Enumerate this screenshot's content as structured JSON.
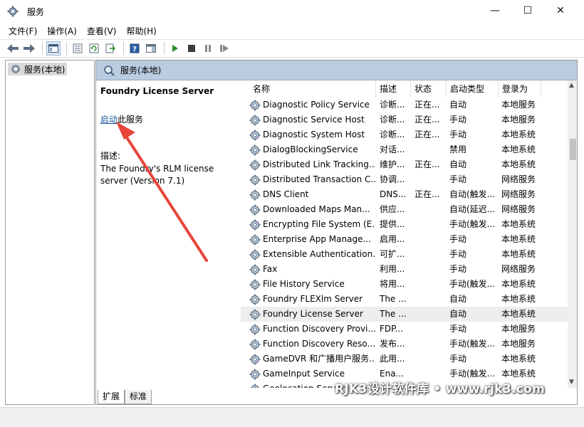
{
  "window": {
    "title": "服务",
    "minimize_glyph": "—",
    "maximize_glyph": "☐",
    "close_glyph": "✕"
  },
  "menu": [
    {
      "label": "文件(F)"
    },
    {
      "label": "操作(A)"
    },
    {
      "label": "查看(V)"
    },
    {
      "label": "帮助(H)"
    }
  ],
  "toolbar": {
    "icons": [
      "back-arrow-icon",
      "forward-arrow-icon",
      "console-tree-icon",
      "properties-icon",
      "refresh-icon",
      "export-list-icon",
      "help-icon",
      "action-pane-icon",
      "start-service-icon",
      "stop-service-icon",
      "pause-service-icon",
      "restart-service-icon"
    ],
    "accent": "#2a8a2a"
  },
  "left_pane": {
    "tree_item": "服务(本地)"
  },
  "right_pane": {
    "header": "服务(本地)",
    "header_color": "#b9cce0",
    "detail": {
      "service_name": "Foundry License Server",
      "start_link": "启动",
      "start_suffix": "此服务",
      "desc_label": "描述:",
      "desc_text": "The Foundry's RLM license server (Version 7.1)"
    }
  },
  "service_list": {
    "columns": {
      "name": "名称",
      "desc": "描述",
      "status": "状态",
      "startup": "启动类型",
      "logon": "登录为"
    },
    "sort_caret": "^",
    "rows": [
      {
        "name": "Diagnostic Policy Service",
        "desc": "诊断...",
        "status": "正在...",
        "startup": "自动",
        "logon": "本地服务"
      },
      {
        "name": "Diagnostic Service Host",
        "desc": "诊断...",
        "status": "正在...",
        "startup": "手动",
        "logon": "本地服务"
      },
      {
        "name": "Diagnostic System Host",
        "desc": "诊断...",
        "status": "正在...",
        "startup": "手动",
        "logon": "本地系统"
      },
      {
        "name": "DialogBlockingService",
        "desc": "对话...",
        "status": "",
        "startup": "禁用",
        "logon": "本地系统"
      },
      {
        "name": "Distributed Link Tracking...",
        "desc": "维护...",
        "status": "正在...",
        "startup": "自动",
        "logon": "本地系统"
      },
      {
        "name": "Distributed Transaction C...",
        "desc": "协调...",
        "status": "",
        "startup": "手动",
        "logon": "网络服务"
      },
      {
        "name": "DNS Client",
        "desc": "DNS...",
        "status": "正在...",
        "startup": "自动(触发...",
        "logon": "网络服务"
      },
      {
        "name": "Downloaded Maps Man...",
        "desc": "供应...",
        "status": "",
        "startup": "自动(延迟...",
        "logon": "网络服务"
      },
      {
        "name": "Encrypting File System (E...",
        "desc": "提供...",
        "status": "",
        "startup": "手动(触发...",
        "logon": "本地系统"
      },
      {
        "name": "Enterprise App Manage...",
        "desc": "启用...",
        "status": "",
        "startup": "手动",
        "logon": "本地系统"
      },
      {
        "name": "Extensible Authentication...",
        "desc": "可扩...",
        "status": "",
        "startup": "手动",
        "logon": "本地系统"
      },
      {
        "name": "Fax",
        "desc": "利用...",
        "status": "",
        "startup": "手动",
        "logon": "网络服务"
      },
      {
        "name": "File History Service",
        "desc": "将用...",
        "status": "",
        "startup": "手动(触发...",
        "logon": "本地系统"
      },
      {
        "name": "Foundry FLEXlm Server",
        "desc": "The ...",
        "status": "",
        "startup": "自动",
        "logon": "本地系统"
      },
      {
        "name": "Foundry License Server",
        "desc": "The ...",
        "status": "",
        "startup": "自动",
        "logon": "本地系统",
        "selected": true
      },
      {
        "name": "Function Discovery Provi...",
        "desc": "FDP...",
        "status": "",
        "startup": "手动",
        "logon": "本地服务"
      },
      {
        "name": "Function Discovery Reso...",
        "desc": "发布...",
        "status": "",
        "startup": "手动(触发...",
        "logon": "本地服务"
      },
      {
        "name": "GameDVR 和广播用户服务...",
        "desc": "此用...",
        "status": "",
        "startup": "手动",
        "logon": "本地系统"
      },
      {
        "name": "GameInput Service",
        "desc": "Ena...",
        "status": "",
        "startup": "手动(触发...",
        "logon": "本地系统"
      },
      {
        "name": "Geolocation Service",
        "desc": "",
        "status": "",
        "startup": "",
        "logon": ""
      }
    ]
  },
  "tabs": {
    "extended": "扩展",
    "standard": "标准"
  },
  "watermark": "RJK3设计软件库 • www.rjk3.com",
  "annotation_color": "#e8463a"
}
